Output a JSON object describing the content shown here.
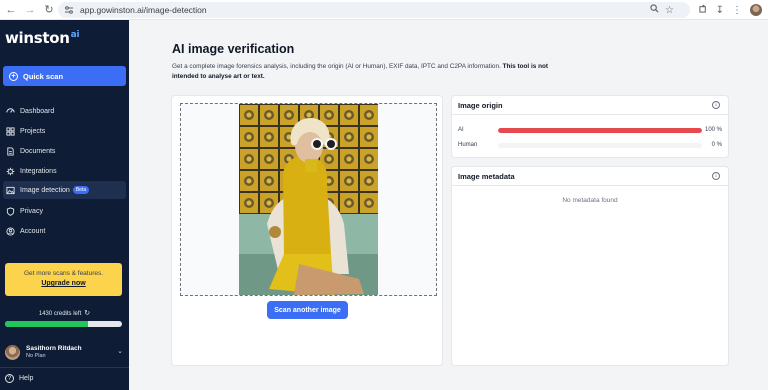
{
  "browser": {
    "url": "app.gowinston.ai/image-detection"
  },
  "sidebar": {
    "logo_text": "winston",
    "logo_suffix": "ai",
    "quick_scan": "Quick scan",
    "items": [
      {
        "label": "Dashboard",
        "icon": "dashboard-icon"
      },
      {
        "label": "Projects",
        "icon": "projects-icon"
      },
      {
        "label": "Documents",
        "icon": "documents-icon"
      },
      {
        "label": "Integrations",
        "icon": "integrations-icon"
      },
      {
        "label": "Image detection",
        "icon": "image-icon",
        "badge": "Beta",
        "active": true
      },
      {
        "label": "Privacy",
        "icon": "shield-icon"
      },
      {
        "label": "Account",
        "icon": "user-icon"
      }
    ],
    "upgrade": {
      "text": "Get more scans & features.",
      "link": "Upgrade now"
    },
    "credits": {
      "text": "1430 credits left",
      "fraction": 0.71
    },
    "user": {
      "name": "Sasithorn Ritdach",
      "plan": "No Plan"
    },
    "help": "Help"
  },
  "main": {
    "title": "AI image verification",
    "description": "Get a complete image forensics analysis, including the origin (AI or Human), EXIF data, IPTC and C2PA information.",
    "description_bold": "This tool is not intended to analyse art or text.",
    "scan_button": "Scan another image"
  },
  "origin": {
    "title": "Image origin",
    "rows": [
      {
        "label": "AI",
        "value": "100 %",
        "fraction": 1.0,
        "color": "#e5484d"
      },
      {
        "label": "Human",
        "value": "0 %",
        "fraction": 0.0,
        "color": "#22c55e"
      }
    ]
  },
  "metadata": {
    "title": "Image metadata",
    "empty": "No metadata found"
  },
  "colors": {
    "accent": "#3b6ef5",
    "sidebar_bg": "#0e1c36",
    "upgrade_bg": "#fcd34d",
    "ai_bar": "#e5484d",
    "credits_bar": "#22c55e"
  }
}
